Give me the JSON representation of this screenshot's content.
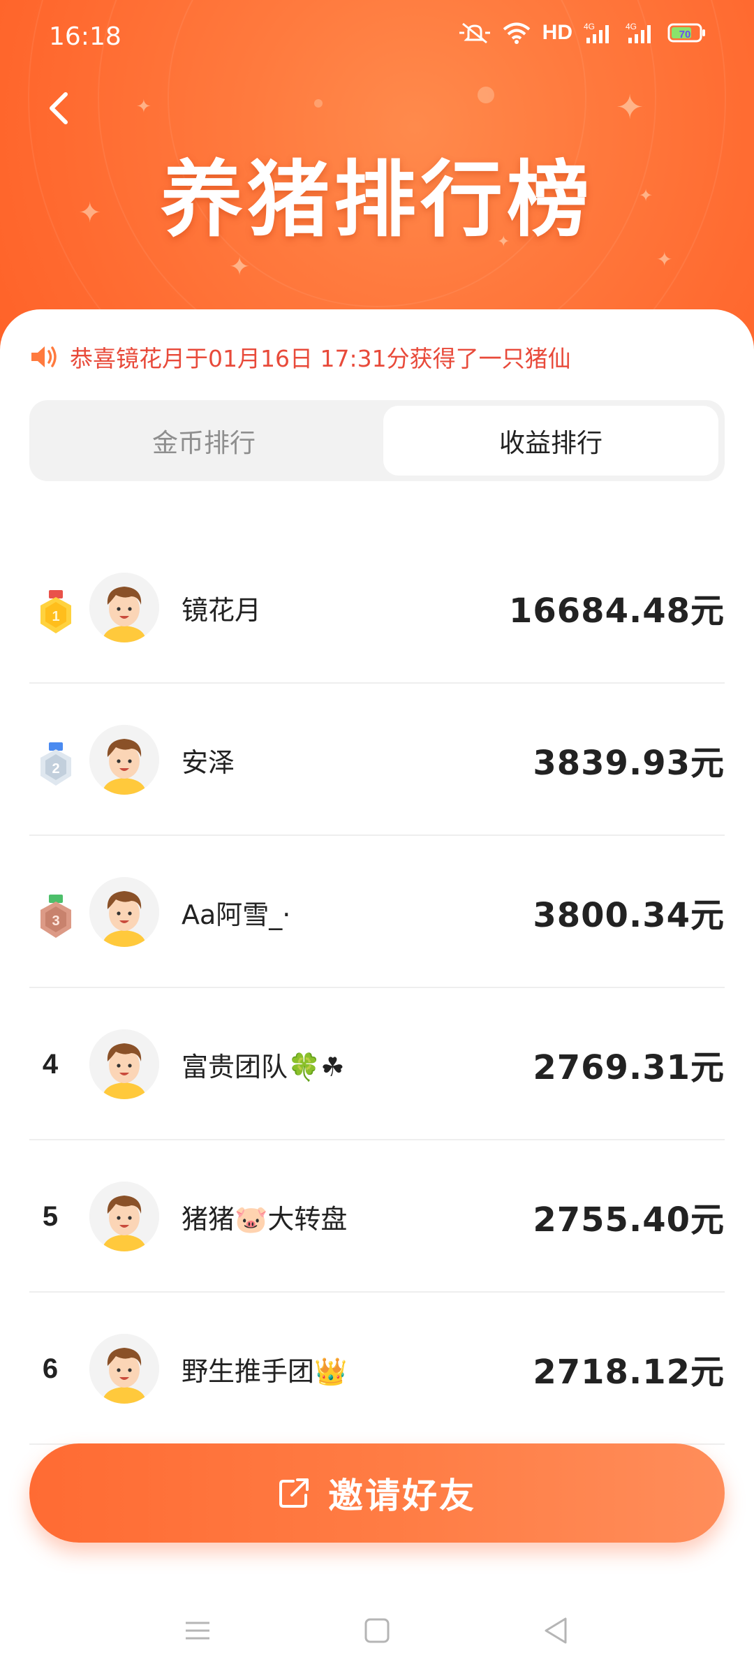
{
  "status_bar": {
    "time": "16:18",
    "hd_label": "HD",
    "network_label_1": "4G",
    "network_label_2": "4G",
    "battery": "70"
  },
  "header": {
    "title": "养猪排行榜",
    "background_color": "#ff6a30"
  },
  "notice": {
    "text": "恭喜镜花月于01月16日 17:31分获得了一只猪仙",
    "color": "#e84a3a"
  },
  "tabs": [
    {
      "label": "金币排行",
      "selected": false
    },
    {
      "label": "收益排行",
      "selected": true
    }
  ],
  "ranking": [
    {
      "rank": "1",
      "medal": "gold-medal-icon",
      "name": "镜花月",
      "amount": "16684.48元"
    },
    {
      "rank": "2",
      "medal": "silver-medal-icon",
      "name": "安泽",
      "amount": "3839.93元"
    },
    {
      "rank": "3",
      "medal": "bronze-medal-icon",
      "name": "Aa阿雪_·",
      "amount": "3800.34元"
    },
    {
      "rank": "4",
      "name": "富贵团队🍀☘",
      "amount": "2769.31元"
    },
    {
      "rank": "5",
      "name": "猪猪🐷大转盘",
      "amount": "2755.40元"
    },
    {
      "rank": "6",
      "name": "野生推手团👑",
      "amount": "2718.12元"
    }
  ],
  "invite_button": {
    "label": "邀请好友",
    "icon": "share-icon",
    "color": "#ff6b33"
  }
}
